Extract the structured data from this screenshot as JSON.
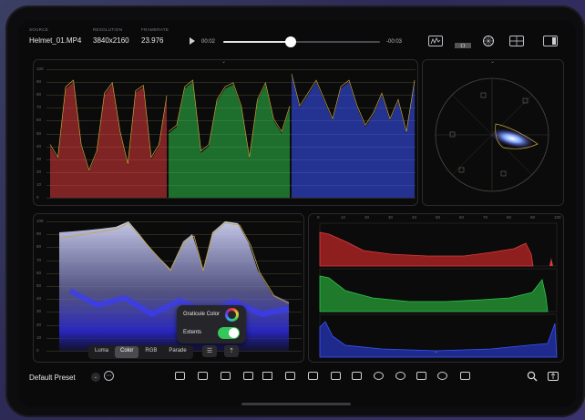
{
  "clip": {
    "source_label": "SOURCE",
    "source_value": "Helmet_01.MP4",
    "resolution_label": "RESOLUTION",
    "resolution_value": "3840x2160",
    "framerate_label": "FRAMERATE",
    "framerate_value": "23.976"
  },
  "playback": {
    "elapsed": "00:02",
    "remaining": "-00:03",
    "progress": 0.43
  },
  "popover": {
    "graticule_label": "Graticule Color",
    "extents_label": "Extents",
    "extents_on": true
  },
  "scope_modes": [
    "Luma",
    "Color",
    "RGB",
    "Parade"
  ],
  "scope_mode_selected": "Color",
  "parade_ticks": [
    "100",
    "90",
    "80",
    "70",
    "60",
    "50",
    "40",
    "30",
    "20",
    "10",
    "0"
  ],
  "histogram_ticks": [
    "0",
    "10",
    "20",
    "30",
    "40",
    "50",
    "60",
    "70",
    "80",
    "90",
    "100"
  ],
  "preset": {
    "label": "Default Preset",
    "more_glyph": "⋯"
  },
  "icons": {
    "top": [
      "waveform-icon",
      "parade-icon",
      "vectorscope-icon",
      "layout-grid-icon",
      "sidebar-icon"
    ],
    "tools": [
      "add-scope-icon",
      "frame-icon",
      "safe-area-icon",
      "crop-icon",
      "split-icon",
      "image-icon",
      "nd-filter-icon",
      "camera-icon",
      "no-icon",
      "timer-icon",
      "cube-icon",
      "palette-icon",
      "target-icon"
    ],
    "bottom_right": [
      "search-icon",
      "share-icon"
    ]
  },
  "colors": {
    "accent_toggle": "#34c759",
    "red_channel": "#e03b3b",
    "green_channel": "#2fc24a",
    "blue_channel": "#3a55ff",
    "graticule": "#c9a63a"
  }
}
